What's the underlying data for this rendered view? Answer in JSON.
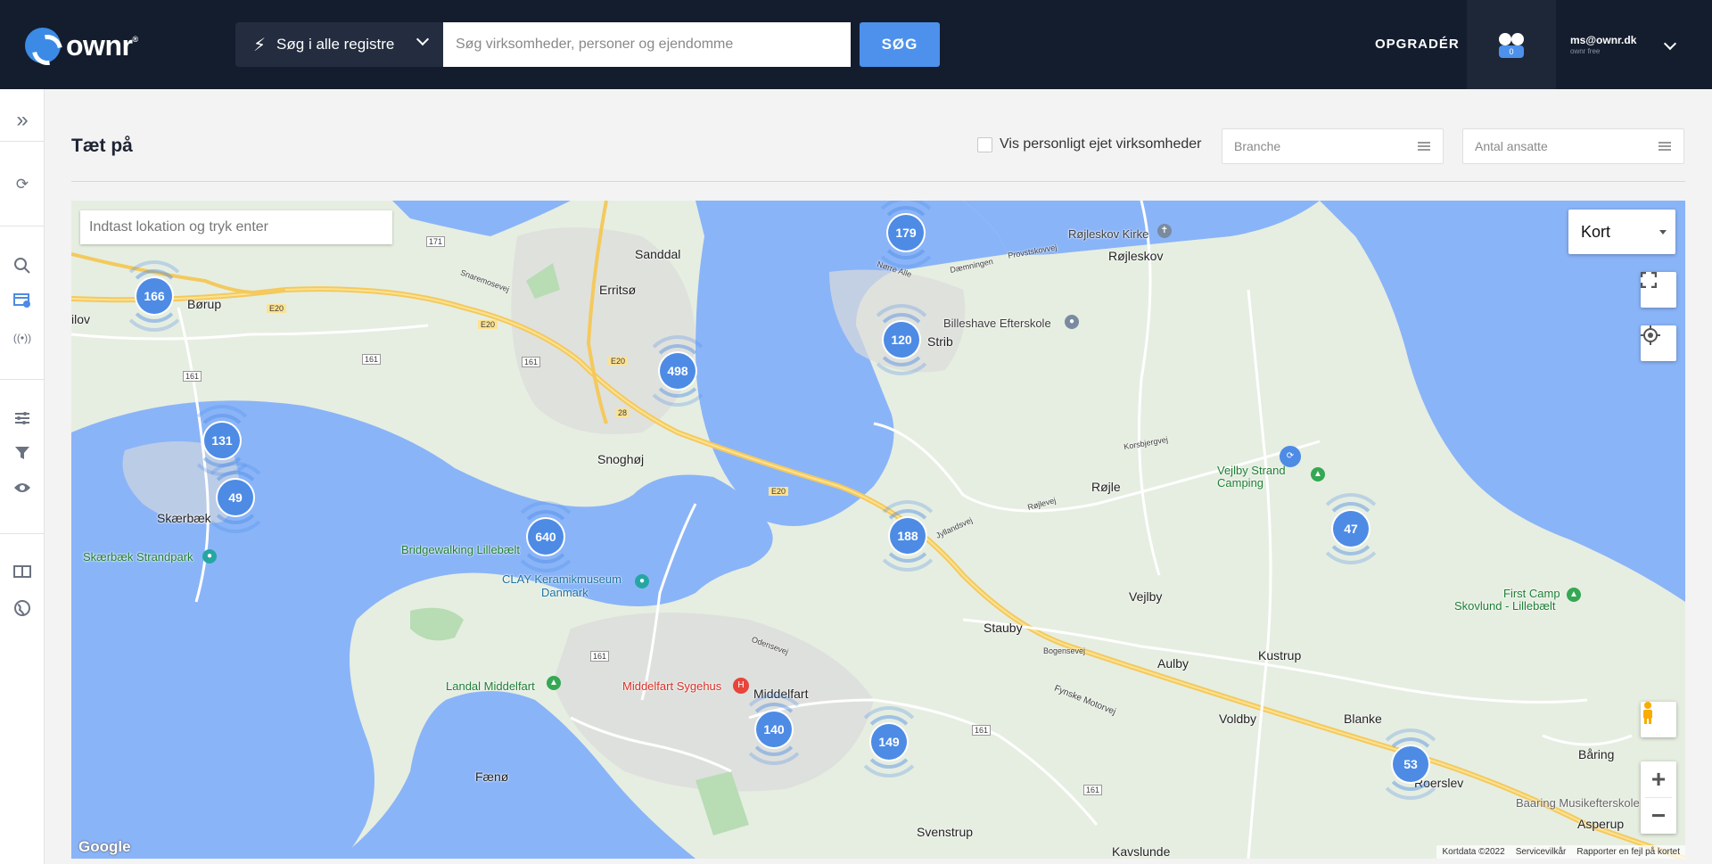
{
  "header": {
    "logo_text": "ownr",
    "logo_reg": "®",
    "registry_label": "Søg i alle registre",
    "search_placeholder": "Søg virksomheder, personer og ejendomme",
    "search_button": "SØG",
    "upgrade_label": "OPGRADÉR",
    "watch_count": "0",
    "user_email": "ms@ownr.dk",
    "user_plan": "ownr free"
  },
  "sidebar": {
    "items": [
      {
        "icon": "expand-icon",
        "glyph": "»"
      },
      {
        "icon": "ownr-logo-icon",
        "glyph": "⟳"
      },
      {
        "icon": "search-icon",
        "glyph": "⌕"
      },
      {
        "icon": "companies-icon",
        "glyph": "▤"
      },
      {
        "icon": "nearby-icon",
        "glyph": "((•))"
      },
      {
        "icon": "sliders-icon",
        "glyph": "☰"
      },
      {
        "icon": "filter-icon",
        "glyph": "▼"
      },
      {
        "icon": "watch-icon",
        "glyph": "◉"
      },
      {
        "icon": "book-icon",
        "glyph": "▭"
      },
      {
        "icon": "globe-icon",
        "glyph": "◍"
      }
    ]
  },
  "page": {
    "title": "Tæt på",
    "checkbox_label": "Vis personligt ejet virksomheder",
    "filter_branche": "Branche",
    "filter_ansatte": "Antal ansatte"
  },
  "map": {
    "search_placeholder": "Indtast lokation og tryk enter",
    "maptype_label": "Kort",
    "fullscreen_icon": "fullscreen-icon",
    "locate_icon": "locate-icon",
    "pegman_icon": "pegman-icon",
    "zoom_in": "+",
    "zoom_out": "−",
    "google_logo": "Google",
    "attribution": [
      "Kortdata ©2022",
      "Servicevilkår",
      "Rapporter en fejl på kortet"
    ],
    "clusters": [
      "166",
      "131",
      "49",
      "498",
      "179",
      "120",
      "640",
      "188",
      "47",
      "140",
      "149",
      "53"
    ],
    "places": [
      "Sanddal",
      "Erritsø",
      "Børup",
      "ilov",
      "Skærbæk",
      "Skærbæk Strandpark",
      "Snoghøj",
      "Bridgewalking Lillebælt",
      "CLAY Keramikmuseum",
      "Danmark",
      "Strib",
      "Billeshave Efterskole",
      "Røjleskov Kirke",
      "Røjleskov",
      "Røjle",
      "Vejlby Strand Camping",
      "Vejlby",
      "Stauby",
      "Aulby",
      "Kustrup",
      "First Camp",
      "Skovlund - Lillebælt",
      "Middelfart",
      "Middelfart Sygehus",
      "Landal Middelfart",
      "Fænø",
      "Strib",
      "Svenstrup",
      "Voldby",
      "Blanke",
      "Roerslev",
      "Båring",
      "Baaring Musikefterskole",
      "Asperup",
      "Kavslunde",
      "Fynske Motorvej",
      "Nørre Alle",
      "Dæmningen",
      "Provstskovvej",
      "Bogensevej",
      "Korsbjergvej",
      "Røjlevej",
      "Jyllandsvej",
      "Odensevej",
      "Snaremosevej"
    ],
    "road_labels": [
      "E20",
      "E20",
      "E20",
      "E20",
      "161",
      "161",
      "161",
      "161",
      "161",
      "161",
      "171",
      "28"
    ]
  }
}
